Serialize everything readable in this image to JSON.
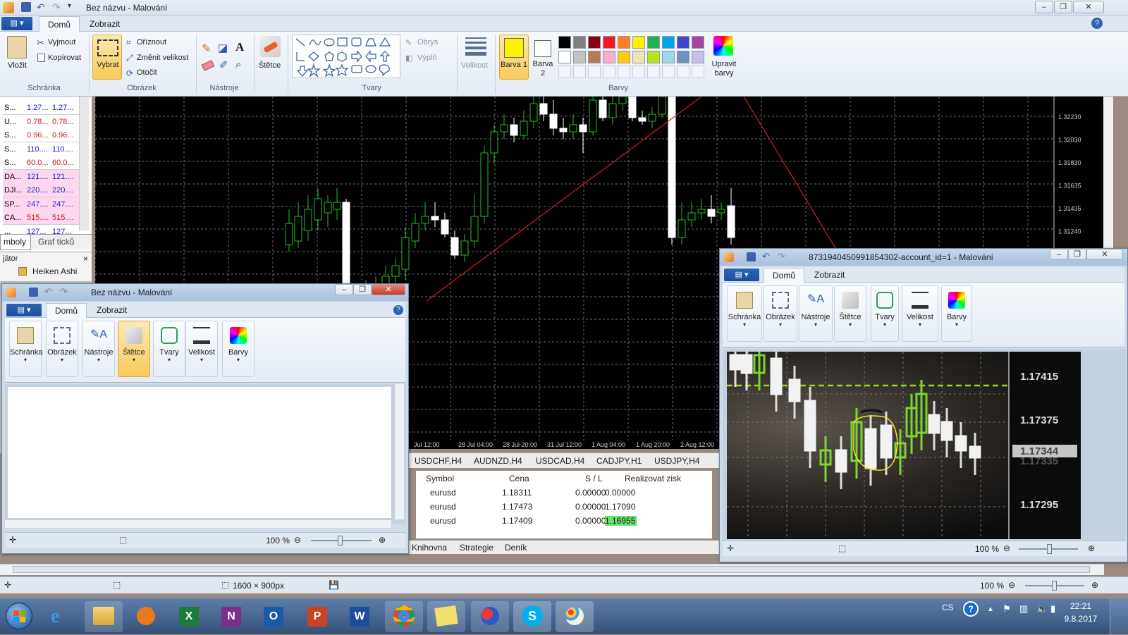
{
  "app": {
    "title": "Bez názvu - Malování",
    "tabs": [
      "Domů",
      "Zobrazit"
    ],
    "file_menu": "▤ ▾"
  },
  "ribbon": {
    "clipboard": {
      "paste": "Vložit",
      "cut": "Vyjmout",
      "copy": "Kopírovat",
      "group": "Schránka"
    },
    "image": {
      "select": "Vybrat",
      "crop": "Oříznout",
      "resize": "Změnit velikost",
      "rotate": "Otočit",
      "group": "Obrázek"
    },
    "tools": {
      "group": "Nástroje"
    },
    "brushes": {
      "label": "Štětce"
    },
    "shapes": {
      "outline": "Obrys",
      "fill": "Výplň",
      "group": "Tvary"
    },
    "size": {
      "label": "Velikost"
    },
    "color1": {
      "label": "Barva 1"
    },
    "color2": {
      "label": "Barva 2"
    },
    "colors": {
      "group": "Barvy",
      "edit": "Upravit barvy"
    },
    "palette": [
      "#000000",
      "#7f7f7f",
      "#880015",
      "#ed1c24",
      "#ff7f27",
      "#fff200",
      "#22b14c",
      "#00a2e8",
      "#3f48cc",
      "#a349a4",
      "#ffffff",
      "#c3c3c3",
      "#b97a57",
      "#ffaec9",
      "#ffc90e",
      "#efe4b0",
      "#b5e61d",
      "#99d9ea",
      "#7092be",
      "#c8bfe7"
    ],
    "colors_hex": {
      "color1": "#fff200",
      "color2": "#ffffff"
    }
  },
  "symbols": {
    "rows": [
      {
        "sym": "S...",
        "bid": "1.27...",
        "ask": "1.27...",
        "color": "#1a1ad0"
      },
      {
        "sym": "U...",
        "bid": "0.78...",
        "ask": "0.78...",
        "color": "#d01a1a"
      },
      {
        "sym": "S...",
        "bid": "0.96...",
        "ask": "0.96...",
        "color": "#d01a1a"
      },
      {
        "sym": "S...",
        "bid": "110....",
        "ask": "110....",
        "color": "#1a1ad0"
      },
      {
        "sym": "S...",
        "bid": "60.0...",
        "ask": "60.0...",
        "color": "#d01a1a"
      },
      {
        "sym": "DA...",
        "bid": "121....",
        "ask": "121....",
        "color": "#1a1ad0"
      },
      {
        "sym": "DJI...",
        "bid": "220....",
        "ask": "220....",
        "color": "#1a1ad0"
      },
      {
        "sym": "SP...",
        "bid": "247....",
        "ask": "247....",
        "color": "#1a1ad0"
      },
      {
        "sym": "CA...",
        "bid": "515....",
        "ask": "515....",
        "color": "#d01a1a"
      },
      {
        "sym": "...",
        "bid": "127...",
        "ask": "127...",
        "color": "#1a1ad0"
      }
    ],
    "tabs": [
      "mboly",
      "Graf ticků"
    ],
    "navigator_title": "játor",
    "navigator_item": "Heiken Ashi"
  },
  "chart": {
    "price_labels": [
      "1.32230",
      "1.32030",
      "1.31830",
      "1.31635",
      "1.31435",
      "1.31240"
    ],
    "time_labels": [
      "Jul 12:00",
      "28 Jul 04:00",
      "28 Jul 20:00",
      "31 Jul 12:00",
      "1 Aug 04:00",
      "1 Aug 20:00",
      "2 Aug 12:00"
    ],
    "chart_tabs": [
      "USDCHF,H4",
      "AUDNZD,H4",
      "USDCAD,H4",
      "CADJPY,H1",
      "USDJPY,H4"
    ]
  },
  "trade_table": {
    "headers": [
      "Symbol",
      "Cena",
      "S / L",
      "Realizovat zisk"
    ],
    "rows": [
      {
        "symbol": "eurusd",
        "price": "1.18311",
        "sl": "0.00000",
        "tp": "0.00000"
      },
      {
        "symbol": "eurusd",
        "price": "1.17473",
        "sl": "0.00000",
        "tp": "1.17090"
      },
      {
        "symbol": "eurusd",
        "price": "1.17409",
        "sl": "0.00000",
        "tp": "1.16955"
      }
    ],
    "bottom_tabs": [
      "Knihovna",
      "Strategie",
      "Deník"
    ]
  },
  "window_left": {
    "title": "Bez názvu - Malování",
    "tabs": [
      "Domů",
      "Zobrazit"
    ],
    "buttons": [
      "Schránka",
      "Obrázek",
      "Nástroje",
      "Štětce",
      "Tvary",
      "Velikost",
      "Barvy"
    ],
    "zoom": "100 %"
  },
  "window_right": {
    "title": "8731940450991854302-account_id=1 - Malování",
    "tabs": [
      "Domů",
      "Zobrazit"
    ],
    "buttons": [
      "Schránka",
      "Obrázek",
      "Nástroje",
      "Štětce",
      "Tvary",
      "Velikost",
      "Barvy"
    ],
    "zoom": "100 %",
    "photo_prices": [
      "1.17415",
      "1.17375",
      "1.17344",
      "1.17335",
      "1.17295"
    ]
  },
  "statusbar": {
    "dimensions": "1600 × 900px",
    "zoom": "100 %"
  },
  "taskbar": {
    "lang": "CS",
    "time": "22:21",
    "date": "9.8.2017"
  }
}
